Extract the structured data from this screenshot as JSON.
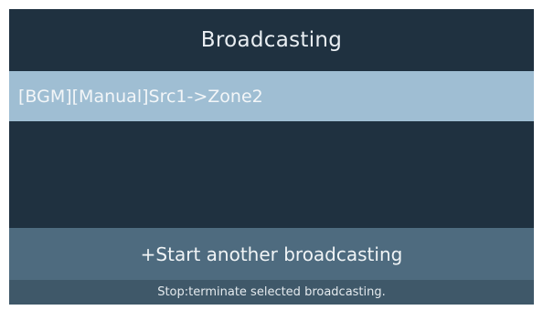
{
  "header": {
    "title": "Broadcasting"
  },
  "broadcast_list": {
    "items": [
      {
        "label": "[BGM][Manual]Src1->Zone2",
        "selected": true
      }
    ]
  },
  "actions": {
    "start_another_label": "+Start another broadcasting"
  },
  "footer": {
    "hint": "Stop:terminate selected broadcasting."
  },
  "colors": {
    "background": "#1f3140",
    "selected_row": "#9fbed3",
    "button": "#4e6b7f",
    "hint_bar": "#3f5869"
  }
}
